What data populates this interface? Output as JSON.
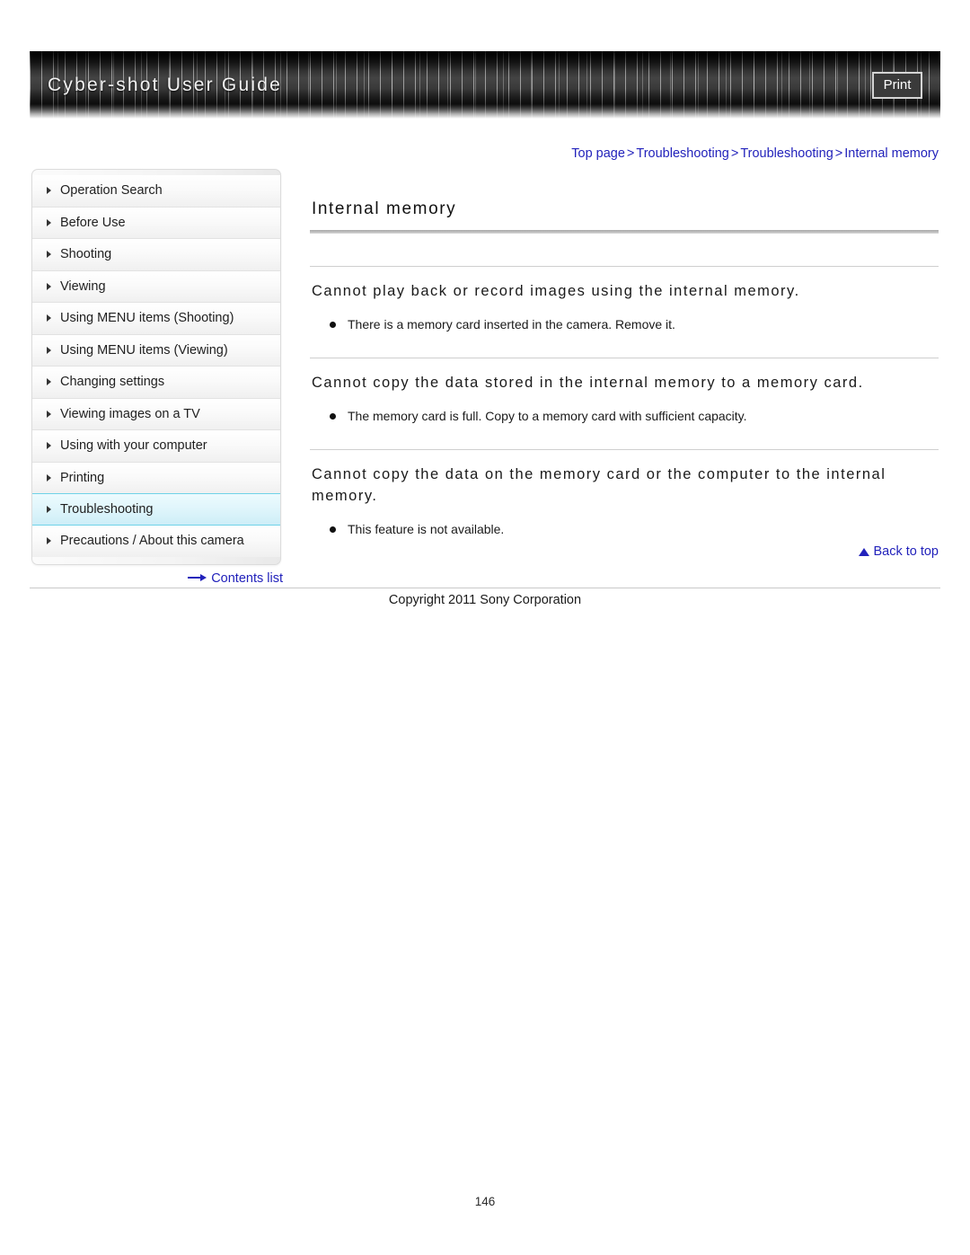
{
  "header": {
    "title": "Cyber-shot User Guide",
    "print_label": "Print"
  },
  "breadcrumb": {
    "items": [
      "Top page",
      "Troubleshooting",
      "Troubleshooting",
      "Internal memory"
    ],
    "separator": ">"
  },
  "sidebar": {
    "items": [
      {
        "label": "Operation Search",
        "active": false
      },
      {
        "label": "Before Use",
        "active": false
      },
      {
        "label": "Shooting",
        "active": false
      },
      {
        "label": "Viewing",
        "active": false
      },
      {
        "label": "Using MENU items (Shooting)",
        "active": false
      },
      {
        "label": "Using MENU items (Viewing)",
        "active": false
      },
      {
        "label": "Changing settings",
        "active": false
      },
      {
        "label": "Viewing images on a TV",
        "active": false
      },
      {
        "label": "Using with your computer",
        "active": false
      },
      {
        "label": "Printing",
        "active": false
      },
      {
        "label": "Troubleshooting",
        "active": true
      },
      {
        "label": "Precautions / About this camera",
        "active": false
      }
    ],
    "contents_link": "Contents list",
    "active_color": "#cdeef7",
    "active_border": "#6fd3e8"
  },
  "main": {
    "page_title": "Internal memory",
    "sections": [
      {
        "heading": "Cannot play back or record images using the internal memory.",
        "bullets": [
          "There is a memory card inserted in the camera. Remove it."
        ]
      },
      {
        "heading": "Cannot copy the data stored in the internal memory to a memory card.",
        "bullets": [
          "The memory card is full. Copy to a memory card with sufficient capacity."
        ]
      },
      {
        "heading": "Cannot copy the data on the memory card or the computer to the internal memory.",
        "bullets": [
          "This feature is not available."
        ]
      }
    ],
    "back_to_top": "Back to top"
  },
  "footer": {
    "copyright": "Copyright 2011 Sony Corporation",
    "page_number": "146"
  },
  "colors": {
    "link": "#2222bb",
    "rule": "#cfcfcf",
    "banner_dark": "#1b1b1b"
  }
}
